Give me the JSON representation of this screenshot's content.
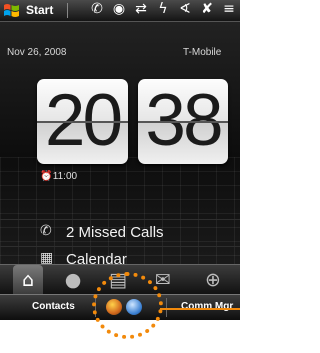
{
  "title_bar": {
    "start_label": "Start",
    "icons": [
      "call-forward-icon",
      "volume-icon",
      "sync-icon",
      "signal-icon",
      "connection-icon",
      "mute-icon",
      "menu-icon"
    ],
    "glyphs": [
      "✆",
      "◉",
      "⇄",
      "ϟ",
      "∢",
      "✘",
      "≡"
    ]
  },
  "home": {
    "date": "Nov 26, 2008",
    "carrier": "T-Mobile",
    "clock": {
      "hour": "20",
      "minute": "38"
    },
    "alarm_time": "11:00",
    "missed_calls_label": "2 Missed Calls",
    "calendar_label": "Calendar"
  },
  "tabs": [
    {
      "name": "home-tab",
      "icon": "home-icon",
      "glyph": "⌂",
      "active": true
    },
    {
      "name": "people-tab",
      "icon": "person-icon",
      "glyph": "●",
      "active": false
    },
    {
      "name": "messages-tab",
      "icon": "message-icon",
      "glyph": "▤",
      "active": false
    },
    {
      "name": "email-tab",
      "icon": "envelope-icon",
      "glyph": "✉",
      "active": false
    },
    {
      "name": "internet-tab",
      "icon": "globe-icon",
      "glyph": "⊕",
      "active": false
    }
  ],
  "soft_bar": {
    "left_label": "Contacts",
    "right_label": "Comm Mgr"
  },
  "colors": {
    "highlight": "#f28a0c",
    "background": "#000000"
  }
}
